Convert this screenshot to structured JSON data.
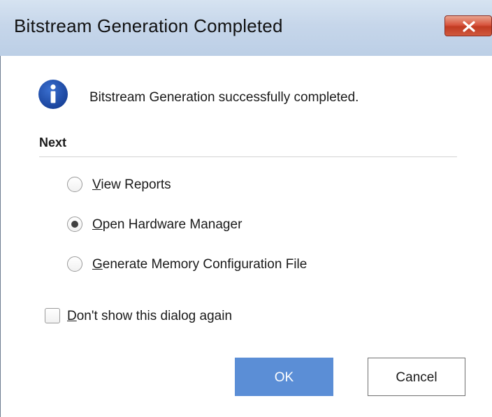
{
  "window": {
    "title": "Bitstream Generation Completed"
  },
  "message": {
    "icon": "info-icon",
    "text": "Bitstream Generation successfully completed."
  },
  "next": {
    "label": "Next",
    "options": [
      {
        "mnemonic": "V",
        "rest": "iew Reports",
        "checked": false
      },
      {
        "mnemonic": "O",
        "rest": "pen Hardware Manager",
        "checked": true
      },
      {
        "mnemonic": "G",
        "rest": "enerate Memory Configuration File",
        "checked": false
      }
    ]
  },
  "dont_show": {
    "mnemonic": "D",
    "rest": "on't show this dialog again",
    "checked": false
  },
  "buttons": {
    "ok": "OK",
    "cancel": "Cancel"
  },
  "colors": {
    "ok_button": "#5b8ed6",
    "info_icon": "#1f4fa8",
    "close_button": "#c9462e"
  }
}
